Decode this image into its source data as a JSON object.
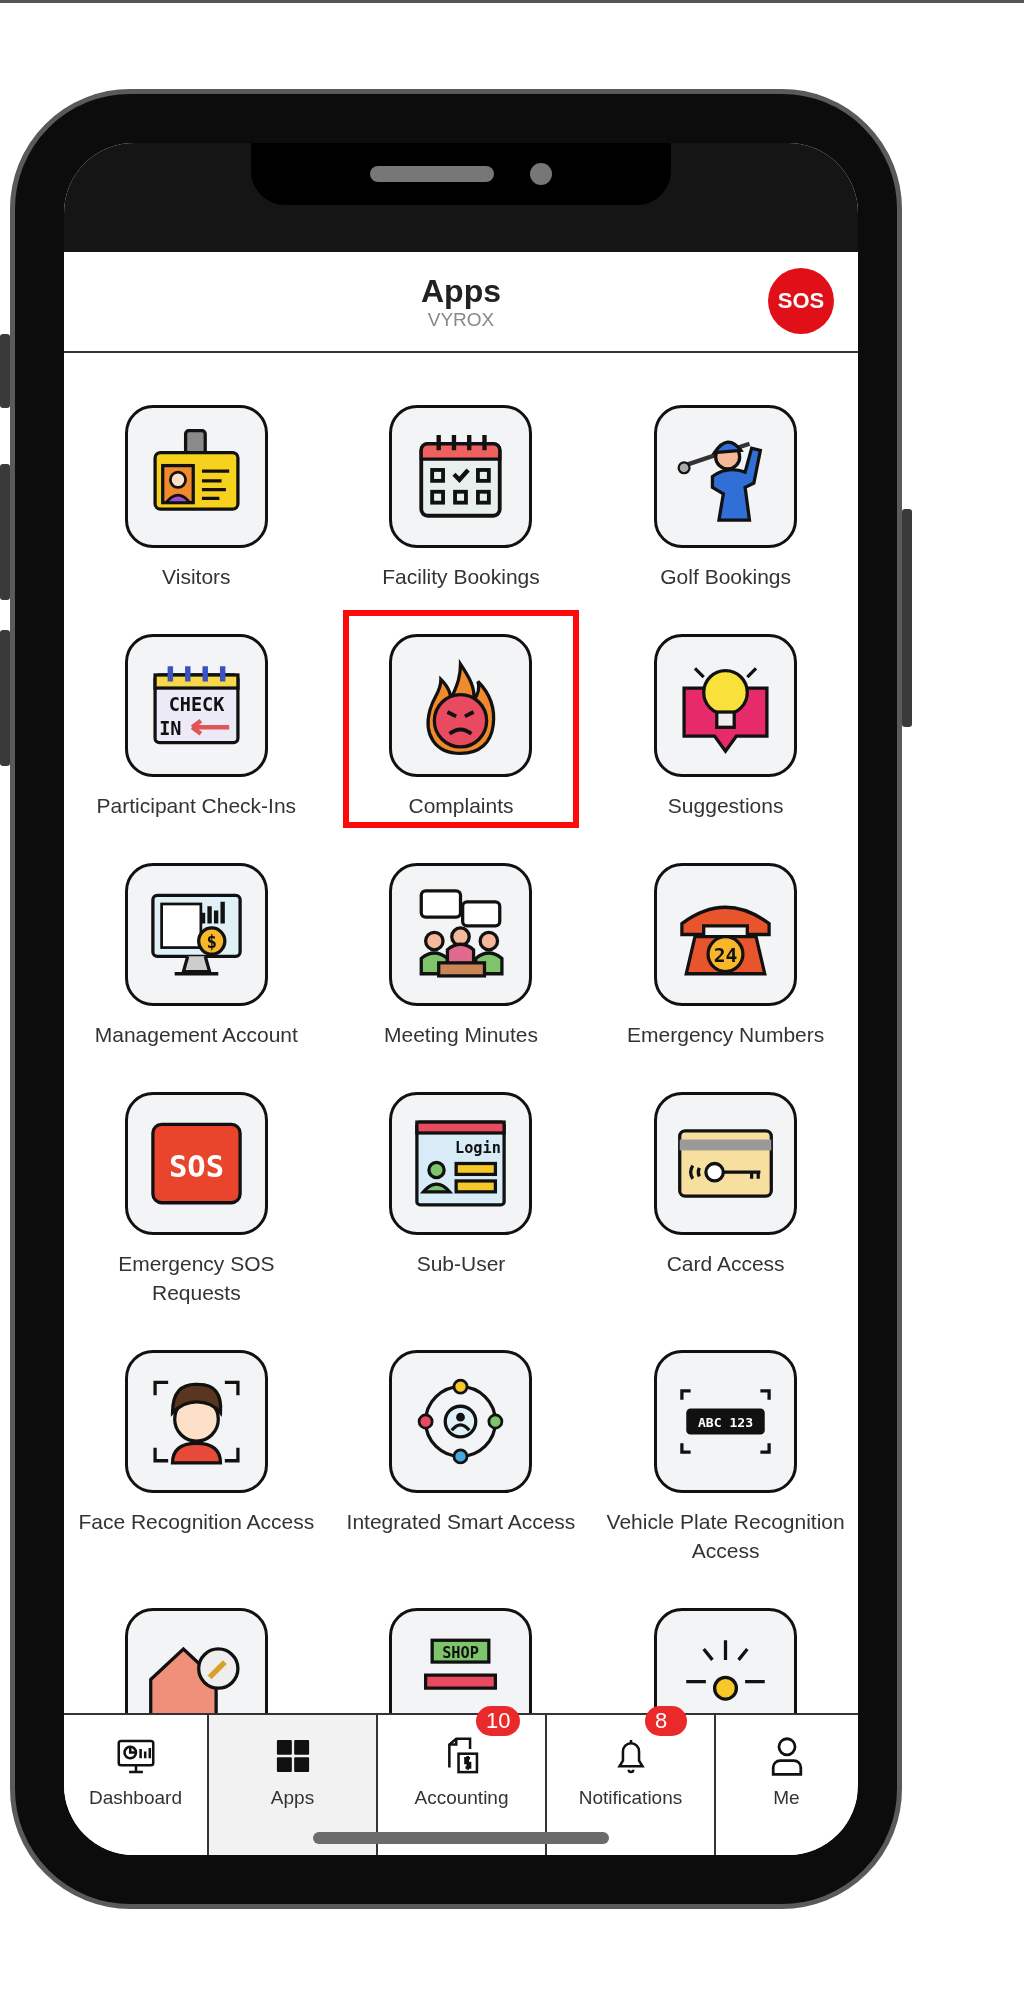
{
  "header": {
    "title": "Apps",
    "subtitle": "VYROX",
    "sos_button": "SOS"
  },
  "apps": [
    {
      "label": "Visitors",
      "highlighted": false
    },
    {
      "label": "Facility Bookings",
      "highlighted": false
    },
    {
      "label": "Golf Bookings",
      "highlighted": false
    },
    {
      "label": "Participant Check-Ins",
      "highlighted": false,
      "icon_text": [
        "CHECK",
        "IN"
      ]
    },
    {
      "label": "Complaints",
      "highlighted": true
    },
    {
      "label": "Suggestions",
      "highlighted": false
    },
    {
      "label": "Management Account",
      "highlighted": false,
      "icon_text": [
        "$"
      ]
    },
    {
      "label": "Meeting Minutes",
      "highlighted": false
    },
    {
      "label": "Emergency Numbers",
      "highlighted": false,
      "icon_text": [
        "24"
      ]
    },
    {
      "label": "Emergency SOS Requests",
      "highlighted": false,
      "icon_text": [
        "SOS"
      ]
    },
    {
      "label": "Sub-User",
      "highlighted": false,
      "icon_text": [
        "Login"
      ]
    },
    {
      "label": "Card Access",
      "highlighted": false
    },
    {
      "label": "Face Recognition Access",
      "highlighted": false
    },
    {
      "label": "Integrated Smart Access",
      "highlighted": false
    },
    {
      "label": "Vehicle Plate Recognition Access",
      "highlighted": false,
      "icon_text": [
        "ABC 123"
      ]
    },
    {
      "highlighted": false
    },
    {
      "highlighted": false,
      "icon_text": [
        "SHOP"
      ]
    },
    {
      "highlighted": false
    }
  ],
  "tab_bar": [
    {
      "label": "Dashboard",
      "selected": false
    },
    {
      "label": "Apps",
      "selected": true
    },
    {
      "label": "Accounting",
      "selected": false,
      "badge": "10"
    },
    {
      "label": "Notifications",
      "selected": false,
      "badge": "8"
    },
    {
      "label": "Me",
      "selected": false
    }
  ]
}
